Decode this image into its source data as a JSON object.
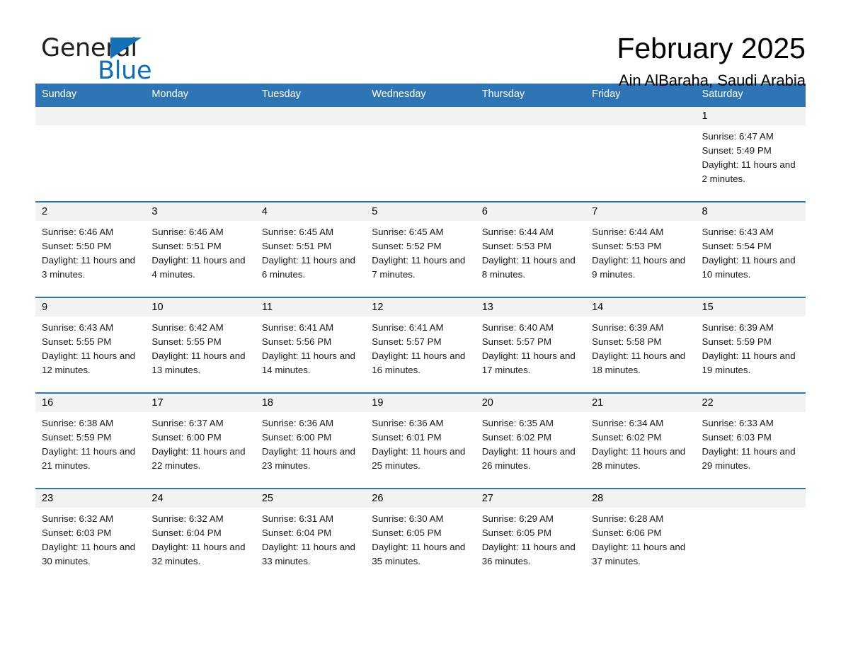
{
  "brand": {
    "name_part1": "General",
    "name_part2": "Blue",
    "triangle_color": "#1371b8",
    "blue_text_color": "#0b6fc0"
  },
  "header": {
    "title": "February 2025",
    "location": "Ain AlBaraha, Saudi Arabia"
  },
  "theme": {
    "header_blue": "#2e75b6",
    "daynum_background": "#f2f2f2",
    "row_border": "#2e75b6"
  },
  "columns": [
    "Sunday",
    "Monday",
    "Tuesday",
    "Wednesday",
    "Thursday",
    "Friday",
    "Saturday"
  ],
  "weeks": [
    [
      {
        "day": "",
        "empty": true
      },
      {
        "day": "",
        "empty": true
      },
      {
        "day": "",
        "empty": true
      },
      {
        "day": "",
        "empty": true
      },
      {
        "day": "",
        "empty": true
      },
      {
        "day": "",
        "empty": true
      },
      {
        "day": "1",
        "sunrise": "Sunrise: 6:47 AM",
        "sunset": "Sunset: 5:49 PM",
        "daylight": "Daylight: 11 hours and 2 minutes."
      }
    ],
    [
      {
        "day": "2",
        "sunrise": "Sunrise: 6:46 AM",
        "sunset": "Sunset: 5:50 PM",
        "daylight": "Daylight: 11 hours and 3 minutes."
      },
      {
        "day": "3",
        "sunrise": "Sunrise: 6:46 AM",
        "sunset": "Sunset: 5:51 PM",
        "daylight": "Daylight: 11 hours and 4 minutes."
      },
      {
        "day": "4",
        "sunrise": "Sunrise: 6:45 AM",
        "sunset": "Sunset: 5:51 PM",
        "daylight": "Daylight: 11 hours and 6 minutes."
      },
      {
        "day": "5",
        "sunrise": "Sunrise: 6:45 AM",
        "sunset": "Sunset: 5:52 PM",
        "daylight": "Daylight: 11 hours and 7 minutes."
      },
      {
        "day": "6",
        "sunrise": "Sunrise: 6:44 AM",
        "sunset": "Sunset: 5:53 PM",
        "daylight": "Daylight: 11 hours and 8 minutes."
      },
      {
        "day": "7",
        "sunrise": "Sunrise: 6:44 AM",
        "sunset": "Sunset: 5:53 PM",
        "daylight": "Daylight: 11 hours and 9 minutes."
      },
      {
        "day": "8",
        "sunrise": "Sunrise: 6:43 AM",
        "sunset": "Sunset: 5:54 PM",
        "daylight": "Daylight: 11 hours and 10 minutes."
      }
    ],
    [
      {
        "day": "9",
        "sunrise": "Sunrise: 6:43 AM",
        "sunset": "Sunset: 5:55 PM",
        "daylight": "Daylight: 11 hours and 12 minutes."
      },
      {
        "day": "10",
        "sunrise": "Sunrise: 6:42 AM",
        "sunset": "Sunset: 5:55 PM",
        "daylight": "Daylight: 11 hours and 13 minutes."
      },
      {
        "day": "11",
        "sunrise": "Sunrise: 6:41 AM",
        "sunset": "Sunset: 5:56 PM",
        "daylight": "Daylight: 11 hours and 14 minutes."
      },
      {
        "day": "12",
        "sunrise": "Sunrise: 6:41 AM",
        "sunset": "Sunset: 5:57 PM",
        "daylight": "Daylight: 11 hours and 16 minutes."
      },
      {
        "day": "13",
        "sunrise": "Sunrise: 6:40 AM",
        "sunset": "Sunset: 5:57 PM",
        "daylight": "Daylight: 11 hours and 17 minutes."
      },
      {
        "day": "14",
        "sunrise": "Sunrise: 6:39 AM",
        "sunset": "Sunset: 5:58 PM",
        "daylight": "Daylight: 11 hours and 18 minutes."
      },
      {
        "day": "15",
        "sunrise": "Sunrise: 6:39 AM",
        "sunset": "Sunset: 5:59 PM",
        "daylight": "Daylight: 11 hours and 19 minutes."
      }
    ],
    [
      {
        "day": "16",
        "sunrise": "Sunrise: 6:38 AM",
        "sunset": "Sunset: 5:59 PM",
        "daylight": "Daylight: 11 hours and 21 minutes."
      },
      {
        "day": "17",
        "sunrise": "Sunrise: 6:37 AM",
        "sunset": "Sunset: 6:00 PM",
        "daylight": "Daylight: 11 hours and 22 minutes."
      },
      {
        "day": "18",
        "sunrise": "Sunrise: 6:36 AM",
        "sunset": "Sunset: 6:00 PM",
        "daylight": "Daylight: 11 hours and 23 minutes."
      },
      {
        "day": "19",
        "sunrise": "Sunrise: 6:36 AM",
        "sunset": "Sunset: 6:01 PM",
        "daylight": "Daylight: 11 hours and 25 minutes."
      },
      {
        "day": "20",
        "sunrise": "Sunrise: 6:35 AM",
        "sunset": "Sunset: 6:02 PM",
        "daylight": "Daylight: 11 hours and 26 minutes."
      },
      {
        "day": "21",
        "sunrise": "Sunrise: 6:34 AM",
        "sunset": "Sunset: 6:02 PM",
        "daylight": "Daylight: 11 hours and 28 minutes."
      },
      {
        "day": "22",
        "sunrise": "Sunrise: 6:33 AM",
        "sunset": "Sunset: 6:03 PM",
        "daylight": "Daylight: 11 hours and 29 minutes."
      }
    ],
    [
      {
        "day": "23",
        "sunrise": "Sunrise: 6:32 AM",
        "sunset": "Sunset: 6:03 PM",
        "daylight": "Daylight: 11 hours and 30 minutes."
      },
      {
        "day": "24",
        "sunrise": "Sunrise: 6:32 AM",
        "sunset": "Sunset: 6:04 PM",
        "daylight": "Daylight: 11 hours and 32 minutes."
      },
      {
        "day": "25",
        "sunrise": "Sunrise: 6:31 AM",
        "sunset": "Sunset: 6:04 PM",
        "daylight": "Daylight: 11 hours and 33 minutes."
      },
      {
        "day": "26",
        "sunrise": "Sunrise: 6:30 AM",
        "sunset": "Sunset: 6:05 PM",
        "daylight": "Daylight: 11 hours and 35 minutes."
      },
      {
        "day": "27",
        "sunrise": "Sunrise: 6:29 AM",
        "sunset": "Sunset: 6:05 PM",
        "daylight": "Daylight: 11 hours and 36 minutes."
      },
      {
        "day": "28",
        "sunrise": "Sunrise: 6:28 AM",
        "sunset": "Sunset: 6:06 PM",
        "daylight": "Daylight: 11 hours and 37 minutes."
      },
      {
        "day": "",
        "empty": true
      }
    ]
  ]
}
